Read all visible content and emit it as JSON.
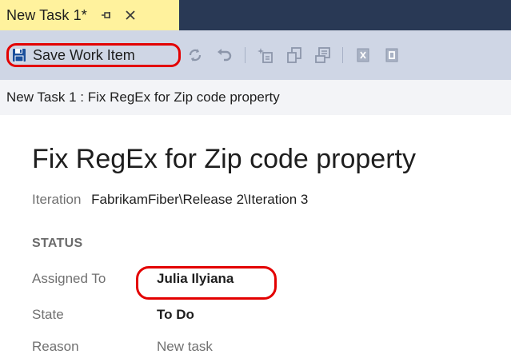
{
  "tab": {
    "title": "New Task 1*",
    "pin_icon": "pin-icon",
    "close_icon": "close-icon"
  },
  "toolbar": {
    "save_label": "Save Work Item",
    "icons": [
      "save-icon",
      "refresh-icon",
      "undo-icon",
      "new-linked-icon",
      "copy-icon",
      "template-icon",
      "excel-icon",
      "project-icon"
    ]
  },
  "breadcrumb": {
    "text": "New Task 1 : Fix RegEx for Zip code property"
  },
  "work_item": {
    "title": "Fix RegEx for Zip code property",
    "iteration_label": "Iteration",
    "iteration_value": "FabrikamFiber\\Release 2\\Iteration 3"
  },
  "status": {
    "heading": "STATUS",
    "fields": [
      {
        "label": "Assigned To",
        "value": "Julia Ilyiana"
      },
      {
        "label": "State",
        "value": "To Do"
      },
      {
        "label": "Reason",
        "value": "New task"
      }
    ]
  },
  "colors": {
    "tab_active": "#fff29d",
    "tabstrip": "#293955",
    "toolbar": "#cfd6e5",
    "highlight": "#e30000"
  }
}
